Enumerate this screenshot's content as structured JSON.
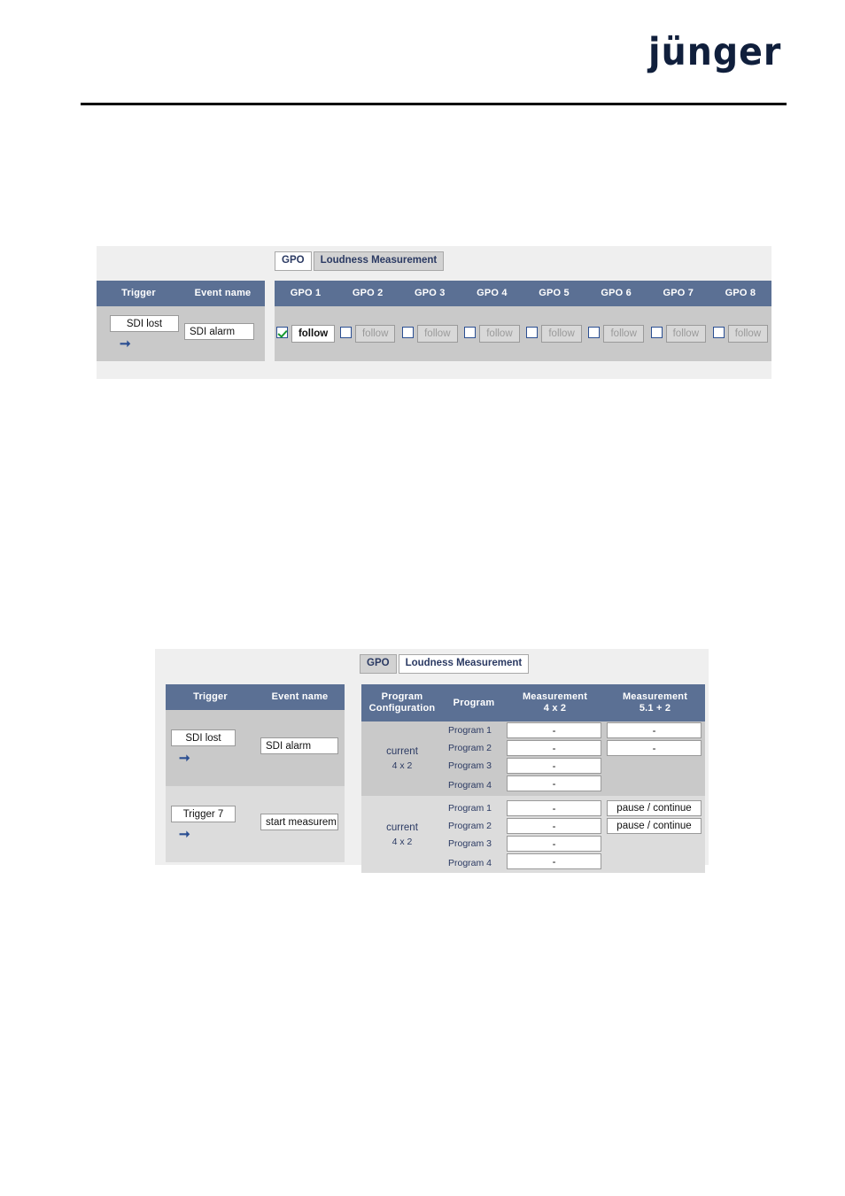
{
  "brand": {
    "logo_text": "jünger"
  },
  "panel_gpo": {
    "tabs": [
      {
        "label": "GPO",
        "state": "active"
      },
      {
        "label": "Loudness Measurement",
        "state": "inactive"
      }
    ],
    "trigger_table": {
      "headers": [
        "Trigger",
        "Event name"
      ],
      "rows": [
        {
          "trigger": "SDI lost",
          "arrow": "arrow-right-icon",
          "event_name": "SDI alarm"
        }
      ]
    },
    "gpo_table": {
      "headers": [
        "GPO 1",
        "GPO 2",
        "GPO 3",
        "GPO 4",
        "GPO 5",
        "GPO 6",
        "GPO 7",
        "GPO 8"
      ],
      "cells": [
        {
          "checked": true,
          "label": "follow",
          "enabled": true
        },
        {
          "checked": false,
          "label": "follow",
          "enabled": false
        },
        {
          "checked": false,
          "label": "follow",
          "enabled": false
        },
        {
          "checked": false,
          "label": "follow",
          "enabled": false
        },
        {
          "checked": false,
          "label": "follow",
          "enabled": false
        },
        {
          "checked": false,
          "label": "follow",
          "enabled": false
        },
        {
          "checked": false,
          "label": "follow",
          "enabled": false
        },
        {
          "checked": false,
          "label": "follow",
          "enabled": false
        }
      ]
    }
  },
  "panel_loudness": {
    "tabs": [
      {
        "label": "GPO",
        "state": "inactive"
      },
      {
        "label": "Loudness Measurement",
        "state": "active"
      }
    ],
    "trigger_table": {
      "headers": [
        "Trigger",
        "Event name"
      ],
      "rows": [
        {
          "trigger": "SDI lost",
          "arrow": "arrow-right-icon",
          "event_name": "SDI alarm"
        },
        {
          "trigger": "Trigger 7",
          "arrow": "arrow-right-icon",
          "event_name": "start measurem"
        }
      ]
    },
    "measurement_table": {
      "headers": [
        "Program\nConfiguration",
        "Program",
        "Measurement\n4 x 2",
        "Measurement\n5.1 + 2"
      ],
      "header_lines": [
        {
          "l1": "Program",
          "l2": "Configuration"
        },
        {
          "l1": "Program",
          "l2": ""
        },
        {
          "l1": "Measurement",
          "l2": "4 x 2"
        },
        {
          "l1": "Measurement",
          "l2": "5.1 + 2"
        }
      ],
      "blocks": [
        {
          "config_title": "current",
          "config_sub": "4 x 2",
          "rows": [
            {
              "program": "Program 1",
              "meas_4x2": "-",
              "meas_51_2": "-",
              "meas_51_2_type": "value"
            },
            {
              "program": "Program 2",
              "meas_4x2": "-",
              "meas_51_2": "-",
              "meas_51_2_type": "value"
            },
            {
              "program": "Program 3",
              "meas_4x2": "-",
              "meas_51_2": "",
              "meas_51_2_type": "empty"
            },
            {
              "program": "Program 4",
              "meas_4x2": "-",
              "meas_51_2": "",
              "meas_51_2_type": "empty"
            }
          ]
        },
        {
          "config_title": "current",
          "config_sub": "4 x 2",
          "rows": [
            {
              "program": "Program 1",
              "meas_4x2": "-",
              "meas_51_2": "pause / continue",
              "meas_51_2_type": "button"
            },
            {
              "program": "Program 2",
              "meas_4x2": "-",
              "meas_51_2": "pause / continue",
              "meas_51_2_type": "button"
            },
            {
              "program": "Program 3",
              "meas_4x2": "-",
              "meas_51_2": "",
              "meas_51_2_type": "empty"
            },
            {
              "program": "Program 4",
              "meas_4x2": "-",
              "meas_51_2": "",
              "meas_51_2_type": "empty"
            }
          ]
        }
      ]
    }
  },
  "colors": {
    "brand_navy": "#101f3c",
    "table_header": "#5b7094",
    "panel_bg": "#efefef",
    "row_block_a": "#c9c9c9",
    "row_block_b": "#dcdcdc",
    "accent_blue": "#2b4f92",
    "check_green": "#169a2e"
  }
}
